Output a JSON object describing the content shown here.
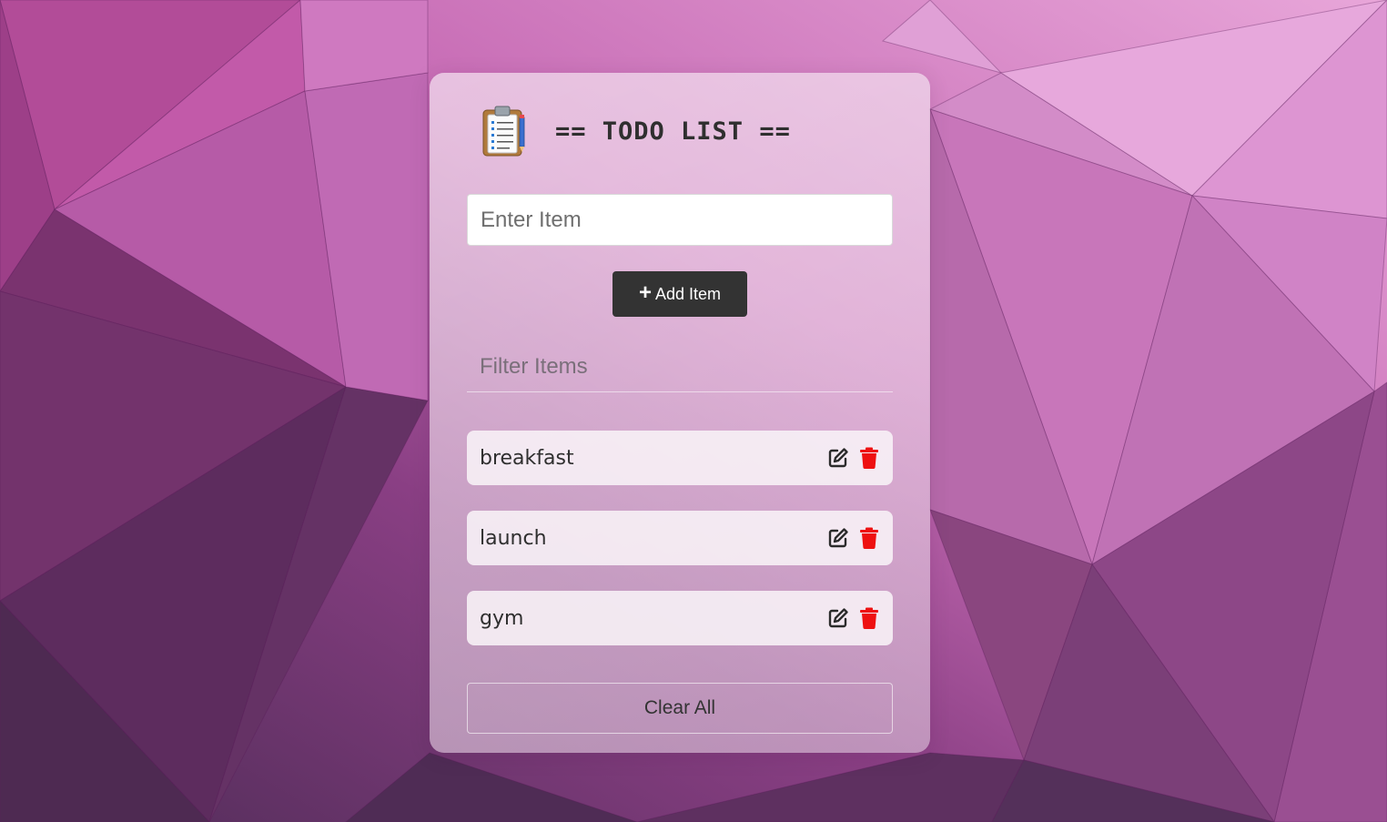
{
  "header": {
    "icon": "clipboard-icon",
    "title": "== TODO LIST =="
  },
  "item_input": {
    "placeholder": "Enter Item",
    "value": ""
  },
  "add_button": {
    "icon": "plus-icon",
    "icon_glyph": "+",
    "label": "Add Item"
  },
  "filter_input": {
    "placeholder": "Filter Items",
    "value": ""
  },
  "items": [
    {
      "text": "breakfast",
      "edit_icon": "edit-icon",
      "delete_icon": "trash-icon"
    },
    {
      "text": "launch",
      "edit_icon": "edit-icon",
      "delete_icon": "trash-icon"
    },
    {
      "text": "gym",
      "edit_icon": "edit-icon",
      "delete_icon": "trash-icon"
    }
  ],
  "clear_button": {
    "label": "Clear All"
  },
  "colors": {
    "background_dark": "#6e3a6e",
    "background_light": "#e39bd4",
    "button_dark": "#333333",
    "delete_red": "#ee1111",
    "text_dark": "#2f2f2f"
  }
}
